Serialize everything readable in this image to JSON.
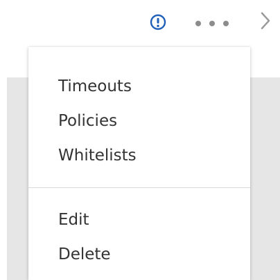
{
  "toolbar": {
    "icons": {
      "alert": "exclamation-circle-icon",
      "more": "more-horizontal-icon",
      "next": "chevron-right-icon"
    },
    "alert_color": "#1f5fb8",
    "more_color": "#8c8c8c",
    "chevron_color": "#9a9a9a"
  },
  "menu": {
    "group_one": [
      {
        "label": "Timeouts"
      },
      {
        "label": "Policies"
      },
      {
        "label": "Whitelists"
      }
    ],
    "group_two": [
      {
        "label": "Edit"
      },
      {
        "label": "Delete"
      }
    ]
  },
  "colors": {
    "menu_text": "#333333",
    "background_panel": "#e6e6e6",
    "divider": "#d8d8d8"
  }
}
